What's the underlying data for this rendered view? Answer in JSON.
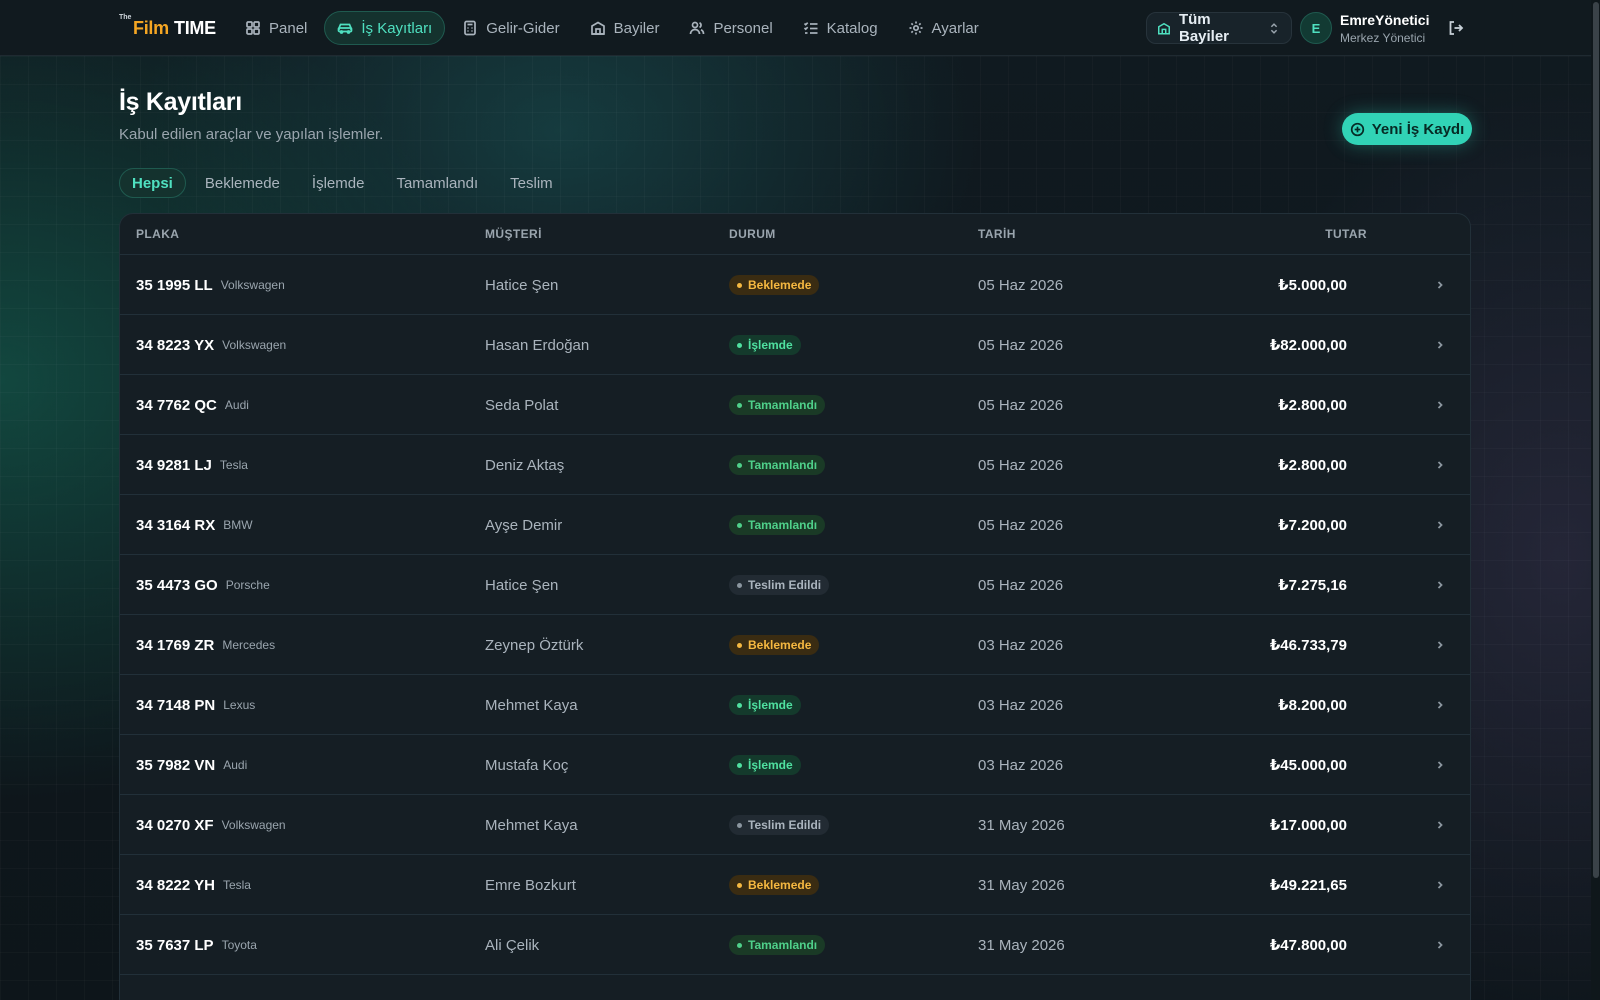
{
  "brand": {
    "the": "The",
    "film": "Film",
    "time": "TIME"
  },
  "nav": [
    {
      "label": "Panel",
      "icon": "grid-icon",
      "active": false
    },
    {
      "label": "İş Kayıtları",
      "icon": "car-icon",
      "active": true
    },
    {
      "label": "Gelir-Gider",
      "icon": "calculator-icon",
      "active": false
    },
    {
      "label": "Bayiler",
      "icon": "building-icon",
      "active": false
    },
    {
      "label": "Personel",
      "icon": "users-icon",
      "active": false
    },
    {
      "label": "Katalog",
      "icon": "list-checks-icon",
      "active": false
    },
    {
      "label": "Ayarlar",
      "icon": "gear-icon",
      "active": false
    }
  ],
  "dealer_select": {
    "value": "Tüm Bayiler"
  },
  "user": {
    "initial": "E",
    "name": "EmreYönetici",
    "role": "Merkez Yönetici"
  },
  "page": {
    "title": "İş Kayıtları",
    "subtitle": "Kabul edilen araçlar ve yapılan işlemler.",
    "new_button": "Yeni İş Kaydı"
  },
  "tabs": [
    {
      "label": "Hepsi",
      "active": true
    },
    {
      "label": "Beklemede",
      "active": false
    },
    {
      "label": "İşlemde",
      "active": false
    },
    {
      "label": "Tamamlandı",
      "active": false
    },
    {
      "label": "Teslim",
      "active": false
    }
  ],
  "table": {
    "columns": {
      "plate": "PLAKA",
      "customer": "MÜŞTERİ",
      "status": "DURUM",
      "date": "TARİH",
      "amount": "TUTAR"
    },
    "rows": [
      {
        "plate": "35 1995 LL",
        "brand": "Volkswagen",
        "customer": "Hatice Şen",
        "status": "Beklemede",
        "status_kind": "pending",
        "date": "05 Haz 2026",
        "amount": "₺5.000,00"
      },
      {
        "plate": "34 8223 YX",
        "brand": "Volkswagen",
        "customer": "Hasan Erdoğan",
        "status": "İşlemde",
        "status_kind": "working",
        "date": "05 Haz 2026",
        "amount": "₺82.000,00"
      },
      {
        "plate": "34 7762 QC",
        "brand": "Audi",
        "customer": "Seda Polat",
        "status": "Tamamlandı",
        "status_kind": "done",
        "date": "05 Haz 2026",
        "amount": "₺2.800,00"
      },
      {
        "plate": "34 9281 LJ",
        "brand": "Tesla",
        "customer": "Deniz Aktaş",
        "status": "Tamamlandı",
        "status_kind": "done",
        "date": "05 Haz 2026",
        "amount": "₺2.800,00"
      },
      {
        "plate": "34 3164 RX",
        "brand": "BMW",
        "customer": "Ayşe Demir",
        "status": "Tamamlandı",
        "status_kind": "done",
        "date": "05 Haz 2026",
        "amount": "₺7.200,00"
      },
      {
        "plate": "35 4473 GO",
        "brand": "Porsche",
        "customer": "Hatice Şen",
        "status": "Teslim Edildi",
        "status_kind": "delivered",
        "date": "05 Haz 2026",
        "amount": "₺7.275,16"
      },
      {
        "plate": "34 1769 ZR",
        "brand": "Mercedes",
        "customer": "Zeynep Öztürk",
        "status": "Beklemede",
        "status_kind": "pending",
        "date": "03 Haz 2026",
        "amount": "₺46.733,79"
      },
      {
        "plate": "34 7148 PN",
        "brand": "Lexus",
        "customer": "Mehmet Kaya",
        "status": "İşlemde",
        "status_kind": "working",
        "date": "03 Haz 2026",
        "amount": "₺8.200,00"
      },
      {
        "plate": "35 7982 VN",
        "brand": "Audi",
        "customer": "Mustafa Koç",
        "status": "İşlemde",
        "status_kind": "working",
        "date": "03 Haz 2026",
        "amount": "₺45.000,00"
      },
      {
        "plate": "34 0270 XF",
        "brand": "Volkswagen",
        "customer": "Mehmet Kaya",
        "status": "Teslim Edildi",
        "status_kind": "delivered",
        "date": "31 May 2026",
        "amount": "₺17.000,00"
      },
      {
        "plate": "34 8222 YH",
        "brand": "Tesla",
        "customer": "Emre Bozkurt",
        "status": "Beklemede",
        "status_kind": "pending",
        "date": "31 May 2026",
        "amount": "₺49.221,65"
      },
      {
        "plate": "35 7637 LP",
        "brand": "Toyota",
        "customer": "Ali Çelik",
        "status": "Tamamlandı",
        "status_kind": "done",
        "date": "31 May 2026",
        "amount": "₺47.800,00"
      }
    ]
  },
  "colors": {
    "accent": "#31d3b6",
    "accent_text": "#4fe0c0",
    "pending": "#f5b841",
    "working": "#4fe0a0",
    "done": "#4fd08a",
    "delivered": "#aab4bd",
    "brand_orange": "#f5a623"
  }
}
